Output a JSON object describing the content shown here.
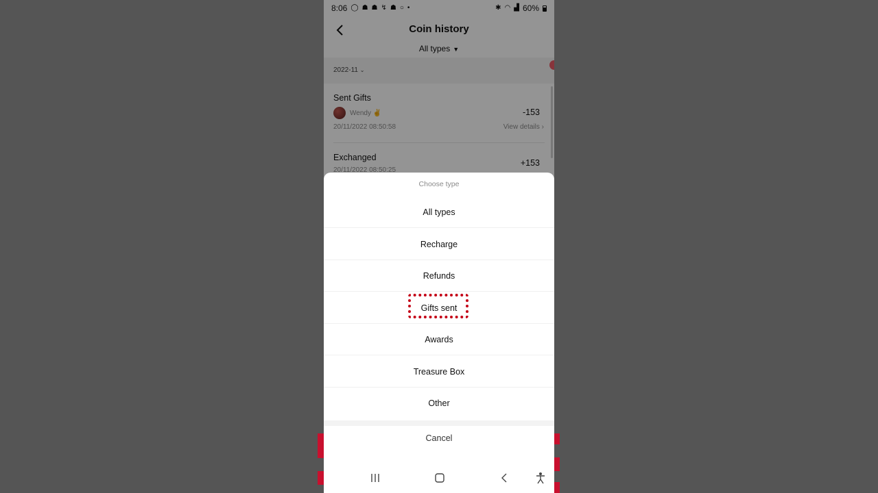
{
  "status_bar": {
    "time": "8:06",
    "battery": "60%",
    "icons_left": [
      "whatsapp-icon",
      "snapchat-icon",
      "snapchat-icon",
      "missed-call-icon",
      "snapchat-icon",
      "circle-icon",
      "dot-icon"
    ],
    "icons_right": [
      "bluetooth-icon",
      "wifi-icon",
      "signal-icon",
      "battery-icon"
    ]
  },
  "header": {
    "title": "Coin history",
    "filter_label": "All types"
  },
  "list": {
    "month": "2022-11",
    "transactions": [
      {
        "title": "Sent Gifts",
        "user": "Wendy ✌",
        "amount": "-153",
        "date": "20/11/2022 08:50:58",
        "details_label": "View details"
      },
      {
        "title": "Exchanged",
        "amount": "+153",
        "date": "20/11/2022 08:50:25"
      }
    ]
  },
  "sheet": {
    "heading": "Choose type",
    "options": [
      "All types",
      "Recharge",
      "Refunds",
      "Gifts sent",
      "Awards",
      "Treasure Box",
      "Other"
    ],
    "highlighted": "Gifts sent",
    "cancel_label": "Cancel"
  },
  "colors": {
    "highlight": "#c40016",
    "overlay": "#000000"
  }
}
